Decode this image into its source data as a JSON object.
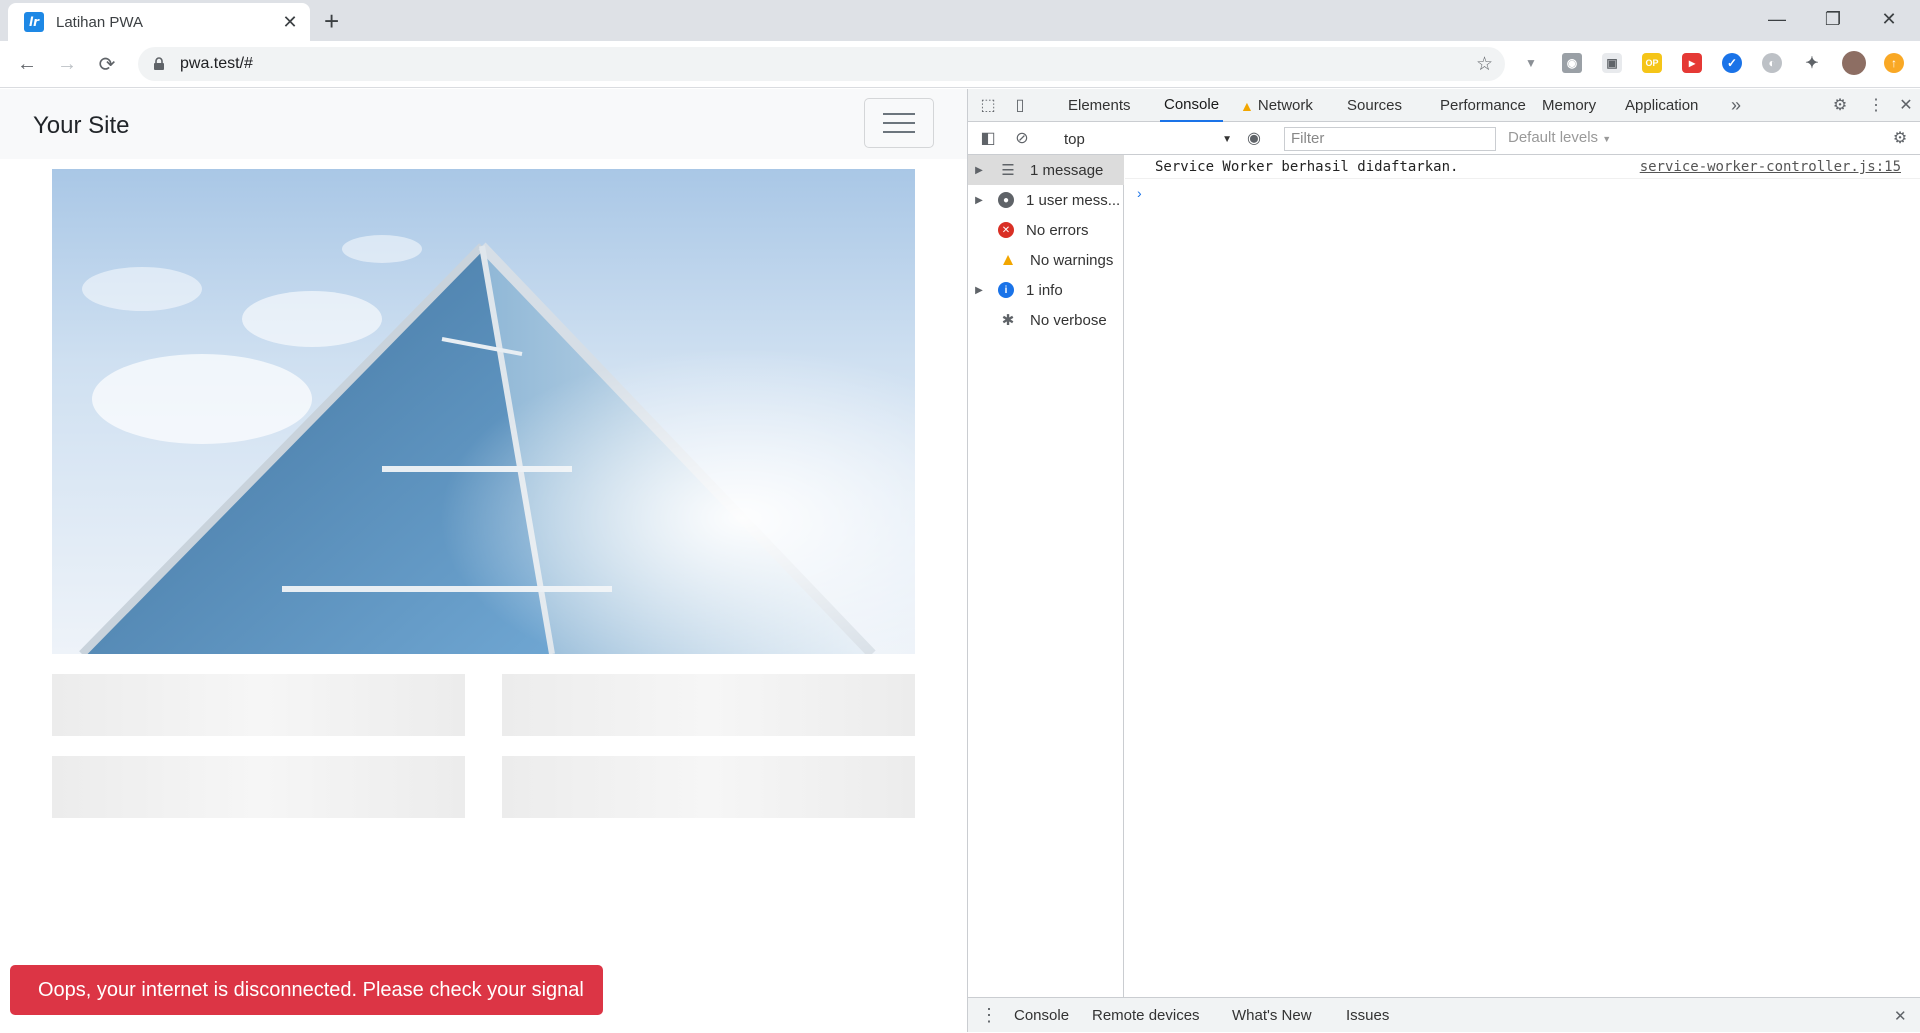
{
  "browser": {
    "tab_title": "Latihan PWA",
    "tab_favicon_text": "lr",
    "url": "pwa.test/#"
  },
  "page": {
    "brand": "Your Site",
    "toast_message": "Oops, your internet is disconnected. Please check your signal"
  },
  "devtools": {
    "tabs": [
      "Elements",
      "Console",
      "Network",
      "Sources",
      "Performance",
      "Memory",
      "Application"
    ],
    "active_tab": "Console",
    "context": "top",
    "filter_placeholder": "Filter",
    "levels": "Default levels",
    "sidebar": [
      {
        "label": "1 message",
        "icon": "list-icon"
      },
      {
        "label": "1 user mess...",
        "icon": "user-icon"
      },
      {
        "label": "No errors",
        "icon": "error-icon"
      },
      {
        "label": "No warnings",
        "icon": "warning-icon"
      },
      {
        "label": "1 info",
        "icon": "info-icon"
      },
      {
        "label": "No verbose",
        "icon": "bug-icon"
      }
    ],
    "log": {
      "message": "Service Worker berhasil didaftarkan.",
      "source": "service-worker-controller.js:15"
    },
    "drawer_tabs": [
      "Console",
      "Remote devices",
      "What's New",
      "Issues"
    ]
  },
  "colors": {
    "toast_bg": "#dc3545",
    "accent": "#1a73e8"
  }
}
